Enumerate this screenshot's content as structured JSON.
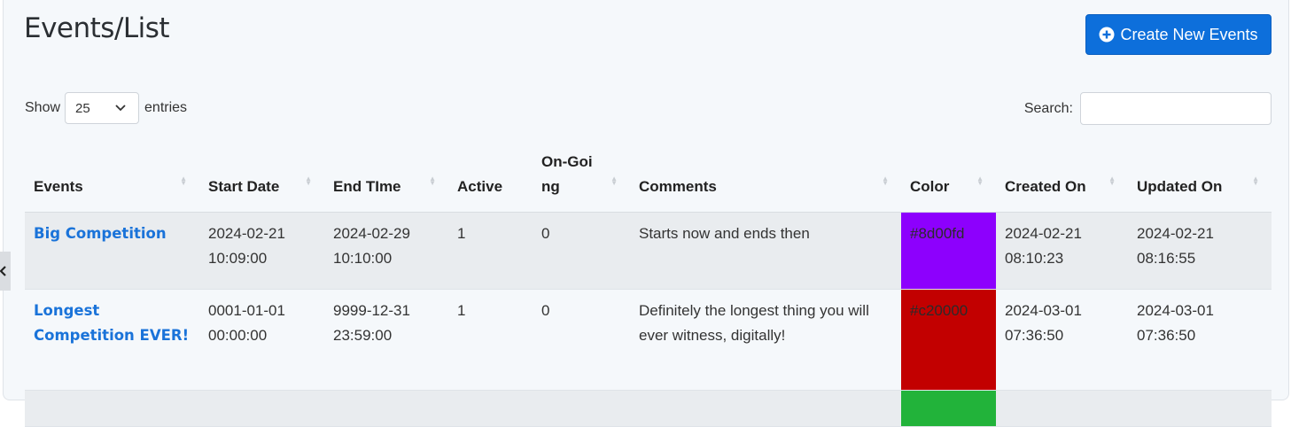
{
  "page": {
    "title": "Events/List",
    "create_button_label": "Create New Events",
    "create_icon": "plus-circle-icon"
  },
  "controls": {
    "show_label": "Show",
    "entries_value": "25",
    "entries_label": "entries",
    "search_label": "Search:",
    "search_value": ""
  },
  "table": {
    "columns": [
      "Events",
      "Start Date",
      "End TIme",
      "Active",
      "On-Going",
      "Comments",
      "Color",
      "Created On",
      "Updated On"
    ],
    "rows": [
      {
        "event": "Big Competition",
        "start_date": "2024-02-21",
        "start_time": "10:09:00",
        "end_date": "2024-02-29",
        "end_time": "10:10:00",
        "active": "1",
        "ongoing": "0",
        "comments": "Starts now and ends then",
        "color": "#8d00fd",
        "created_date": "2024-02-21",
        "created_time": "08:10:23",
        "updated_date": "2024-02-21",
        "updated_time": "08:16:55"
      },
      {
        "event": "Longest Competition EVER!",
        "start_date": "0001-01-01",
        "start_time": "00:00:00",
        "end_date": "9999-12-31",
        "end_time": "23:59:00",
        "active": "1",
        "ongoing": "0",
        "comments": "Definitely the longest thing you will ever witness, digitally!",
        "color": "#c20000",
        "created_date": "2024-03-01",
        "created_time": "07:36:50",
        "updated_date": "2024-03-01",
        "updated_time": "07:36:50"
      }
    ],
    "partial_row_color": "#22b33a"
  },
  "colors": {
    "primary": "#0d6fdb",
    "link": "#1a73d9"
  }
}
